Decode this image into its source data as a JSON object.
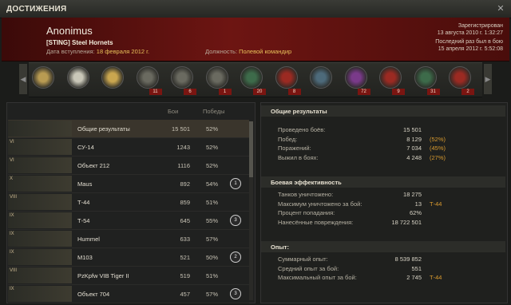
{
  "window": {
    "title": "ДОСТИЖЕНИЯ",
    "close": "✕"
  },
  "player": {
    "nick": "Anonimus",
    "clan": "[STING] Steel Hornets",
    "joined_label": "Дата вступления:",
    "joined_value": "18 февраля 2012 г.",
    "role_label": "Должность:",
    "role_value": "Полевой командир",
    "registered_label": "Зарегистрирован",
    "registered_value": "13 августа 2010 г. 1:32:27",
    "last_seen_label": "Последний раз был в бою",
    "last_seen_value": "15 апреля 2012 г. 5:52:08"
  },
  "medals": [
    {
      "icon": "order-medal-icon",
      "count": ""
    },
    {
      "icon": "star-medal-icon",
      "count": ""
    },
    {
      "icon": "star-medal-gold-icon",
      "count": ""
    },
    {
      "icon": "tank-badge-icon",
      "count": "11"
    },
    {
      "icon": "tank-badge-icon",
      "count": "6"
    },
    {
      "icon": "tank-badge-icon",
      "count": "1"
    },
    {
      "icon": "ribbon-medal-icon",
      "count": "20"
    },
    {
      "icon": "ribbon-medal-icon",
      "count": "8"
    },
    {
      "icon": "ribbon-medal-icon",
      "count": ""
    },
    {
      "icon": "ribbon-medal-icon",
      "count": "72"
    },
    {
      "icon": "ribbon-medal-icon",
      "count": "9"
    },
    {
      "icon": "ribbon-medal-icon",
      "count": "31"
    },
    {
      "icon": "ribbon-medal-icon",
      "count": "2"
    }
  ],
  "table": {
    "headers": {
      "battles": "Бои",
      "wins": "Победы"
    },
    "rows": [
      {
        "tier": "",
        "name": "Общие результаты",
        "battles": "15 501",
        "wins": "52%",
        "badge": ""
      },
      {
        "tier": "VI",
        "name": "СУ-14",
        "battles": "1243",
        "wins": "52%",
        "badge": ""
      },
      {
        "tier": "VI",
        "name": "Объект 212",
        "battles": "1116",
        "wins": "52%",
        "badge": ""
      },
      {
        "tier": "X",
        "name": "Maus",
        "battles": "892",
        "wins": "54%",
        "badge": "1"
      },
      {
        "tier": "VIII",
        "name": "Т-44",
        "battles": "859",
        "wins": "51%",
        "badge": ""
      },
      {
        "tier": "IX",
        "name": "Т-54",
        "battles": "645",
        "wins": "55%",
        "badge": "3"
      },
      {
        "tier": "IX",
        "name": "Hummel",
        "battles": "633",
        "wins": "57%",
        "badge": ""
      },
      {
        "tier": "IX",
        "name": "M103",
        "battles": "521",
        "wins": "50%",
        "badge": "2"
      },
      {
        "tier": "VIII",
        "name": "PzKpfw VIB Tiger II",
        "battles": "519",
        "wins": "51%",
        "badge": ""
      },
      {
        "tier": "IX",
        "name": "Объект 704",
        "battles": "457",
        "wins": "57%",
        "badge": "3"
      }
    ]
  },
  "stats": {
    "general_title": "Общие результаты",
    "general": [
      {
        "label": "Проведено боёв:",
        "value": "15 501",
        "extra": ""
      },
      {
        "label": "Побед:",
        "value": "8 129",
        "extra": "(52%)"
      },
      {
        "label": "Поражений:",
        "value": "7 034",
        "extra": "(45%)"
      },
      {
        "label": "Выжил в боях:",
        "value": "4 248",
        "extra": "(27%)"
      }
    ],
    "combat_title": "Боевая эффективность",
    "combat": [
      {
        "label": "Танков уничтожено:",
        "value": "18 275",
        "extra": ""
      },
      {
        "label": "Максимум уничтожено за бой:",
        "value": "13",
        "extra": "Т-44"
      },
      {
        "label": "Процент попадания:",
        "value": "62%",
        "extra": ""
      },
      {
        "label": "Нанесённые повреждения:",
        "value": "18 722 501",
        "extra": ""
      }
    ],
    "xp_title": "Опыт:",
    "xp": [
      {
        "label": "Суммарный опыт:",
        "value": "8 539 852",
        "extra": ""
      },
      {
        "label": "Средний опыт за бой:",
        "value": "551",
        "extra": ""
      },
      {
        "label": "Максимальный опыт за бой:",
        "value": "2 745",
        "extra": "Т-44"
      }
    ]
  },
  "colors": {
    "header_red": "#6d1512",
    "accent": "#d99a2e"
  }
}
